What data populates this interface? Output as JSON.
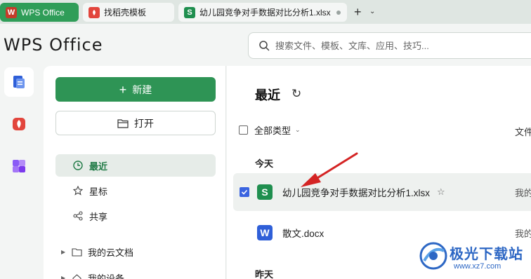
{
  "tabs": [
    {
      "label": "WPS Office",
      "icon": "wps-logo-icon"
    },
    {
      "label": "找稻壳模板",
      "icon": "daoke-icon"
    },
    {
      "label": "幼儿园竞争对手数据对比分析1.xlsx",
      "icon": "spreadsheet-icon"
    }
  ],
  "tab_add": "+",
  "header": {
    "logo": "WPS Office",
    "search_placeholder": "搜索文件、模板、文库、应用、技巧..."
  },
  "sidebar": {
    "new_label": "新建",
    "open_label": "打开",
    "nav": [
      {
        "label": "最近",
        "icon": "clock-icon",
        "active": true
      },
      {
        "label": "星标",
        "icon": "star-icon",
        "active": false
      },
      {
        "label": "共享",
        "icon": "share-icon",
        "active": false
      }
    ],
    "tree": [
      {
        "label": "我的云文档",
        "icon": "cloud-folder-icon"
      },
      {
        "label": "我的设备",
        "icon": "device-icon"
      }
    ]
  },
  "main": {
    "title": "最近",
    "filter_label": "全部类型",
    "column_header": "文件",
    "groups": [
      {
        "label": "今天",
        "files": [
          {
            "name": "幼儿园竞争对手数据对比分析1.xlsx",
            "type": "S",
            "location": "我的",
            "selected": true
          },
          {
            "name": "散文.docx",
            "type": "W",
            "location": "我的",
            "selected": false
          }
        ]
      },
      {
        "label": "昨天",
        "files": []
      }
    ]
  },
  "watermark": {
    "title": "极光下载站",
    "url": "www.xz7.com"
  },
  "colors": {
    "brand_green": "#2e9455",
    "tab_active": "#2f9d58",
    "checkbox_blue": "#3a64e0",
    "annotation_red": "#d42424",
    "watermark_blue": "#2d67c4"
  }
}
